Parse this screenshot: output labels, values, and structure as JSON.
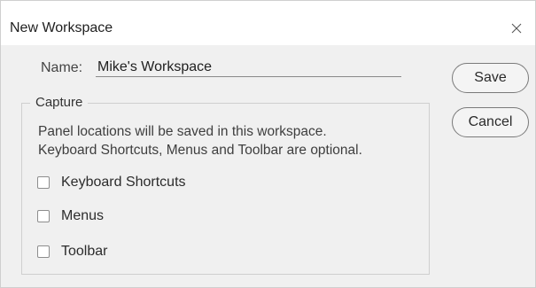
{
  "dialog": {
    "title": "New Workspace",
    "close_icon": "close-icon"
  },
  "name_field": {
    "label": "Name:",
    "value": "Mike's Workspace"
  },
  "capture": {
    "legend": "Capture",
    "description_lines": [
      "Panel locations will be saved in this workspace.",
      "Keyboard Shortcuts, Menus and Toolbar are optional."
    ],
    "options": [
      {
        "label": "Keyboard Shortcuts",
        "checked": false
      },
      {
        "label": "Menus",
        "checked": false
      },
      {
        "label": "Toolbar",
        "checked": false
      }
    ]
  },
  "buttons": {
    "save": "Save",
    "cancel": "Cancel"
  }
}
